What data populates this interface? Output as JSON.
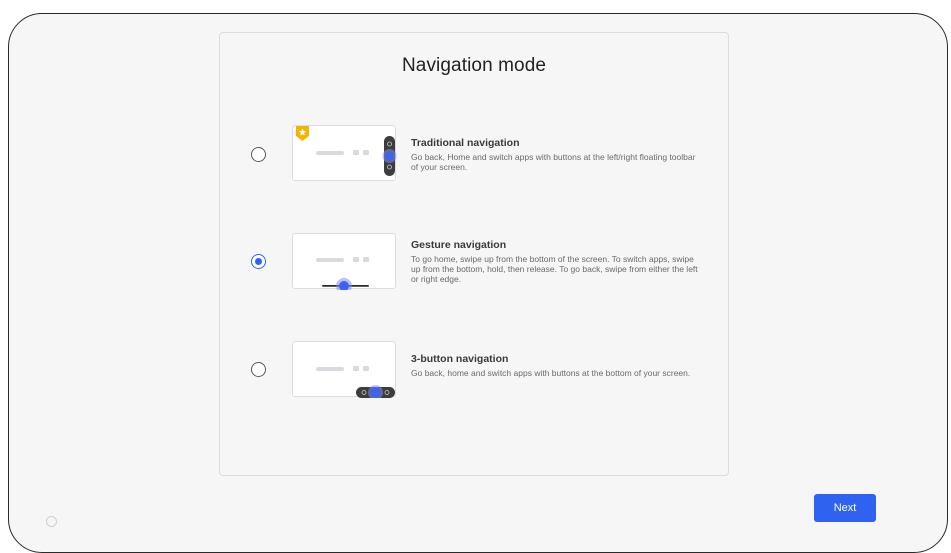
{
  "page": {
    "title": "Navigation mode",
    "next_label": "Next"
  },
  "options": [
    {
      "title": "Traditional navigation",
      "description": "Go back, Home and switch apps with buttons at the left/right floating toolbar of your screen.",
      "selected": false,
      "badge_icon": "star-badge-icon"
    },
    {
      "title": "Gesture navigation",
      "description": "To go home, swipe up from the bottom of the screen. To switch apps, swipe up from the bottom, hold, then release. To go back, swipe from either the left or right edge.",
      "selected": true
    },
    {
      "title": "3-button navigation",
      "description": "Go back, home and switch apps with buttons at the bottom of your screen.",
      "selected": false
    }
  ],
  "colors": {
    "accent": "#2f62f0",
    "badge": "#f4b400"
  }
}
